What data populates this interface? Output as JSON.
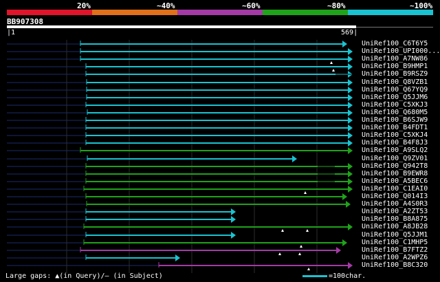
{
  "percent_labels": [
    "20%",
    "~40%",
    "~60%",
    "~80%",
    "~100%"
  ],
  "color_scale": [
    {
      "color": "#e0142a"
    },
    {
      "color": "#e0701a"
    },
    {
      "color": "#a43aa6"
    },
    {
      "color": "#1fa31a"
    },
    {
      "color": "#19c3d1"
    }
  ],
  "query": {
    "name": "BB907308",
    "start": "1",
    "end": "569"
  },
  "hits": [
    {
      "label": "UniRef100_C6T6Y5",
      "color": "#19c3d1",
      "start": 117,
      "end": 505,
      "gaps": []
    },
    {
      "label": "UniRef100_UPI000...",
      "color": "#19c3d1",
      "start": 117,
      "end": 513,
      "gaps": []
    },
    {
      "label": "UniRef100_A7NW86",
      "color": "#19c3d1",
      "start": 117,
      "end": 513,
      "gaps": [
        {
          "type": "query",
          "pos": 482
        }
      ]
    },
    {
      "label": "UniRef100_B9HMP1",
      "color": "#19c3d1",
      "start": 125,
      "end": 513,
      "gaps": [
        {
          "type": "query",
          "pos": 485
        }
      ]
    },
    {
      "label": "UniRef100_B9RSZ9",
      "color": "#19c3d1",
      "start": 125,
      "end": 513,
      "gaps": [
        {
          "type": "subject",
          "pos": 488
        }
      ]
    },
    {
      "label": "UniRef100_Q8VZB1",
      "color": "#19c3d1",
      "start": 126,
      "end": 513,
      "gaps": []
    },
    {
      "label": "UniRef100_Q67YQ9",
      "color": "#19c3d1",
      "start": 126,
      "end": 513,
      "gaps": []
    },
    {
      "label": "UniRef100_Q5JJM6",
      "color": "#19c3d1",
      "start": 126,
      "end": 513,
      "gaps": []
    },
    {
      "label": "UniRef100_C5XKJ3",
      "color": "#19c3d1",
      "start": 125,
      "end": 513,
      "gaps": []
    },
    {
      "label": "UniRef100_Q680M5",
      "color": "#19c3d1",
      "start": 127,
      "end": 513,
      "gaps": []
    },
    {
      "label": "UniRef100_B6SJW9",
      "color": "#19c3d1",
      "start": 125,
      "end": 513,
      "gaps": []
    },
    {
      "label": "UniRef100_B4FDT1",
      "color": "#19c3d1",
      "start": 125,
      "end": 513,
      "gaps": []
    },
    {
      "label": "UniRef100_C5XKJ4",
      "color": "#19c3d1",
      "start": 125,
      "end": 513,
      "gaps": []
    },
    {
      "label": "UniRef100_B4F8J3",
      "color": "#19c3d1",
      "start": 125,
      "end": 513,
      "gaps": []
    },
    {
      "label": "UniRef100_A9SLQ2",
      "color": "#1fa31a",
      "start": 117,
      "end": 513,
      "gaps": []
    },
    {
      "label": "UniRef100_Q9ZV01",
      "color": "#19c3d1",
      "start": 127,
      "end": 432,
      "gaps": []
    },
    {
      "label": "UniRef100_Q942T8",
      "color": "#1fa31a",
      "start": 125,
      "end": 513,
      "gaps": [
        {
          "type": "subject",
          "pos": 462
        }
      ]
    },
    {
      "label": "UniRef100_B9EWR8",
      "color": "#1fa31a",
      "start": 125,
      "end": 513,
      "gaps": [
        {
          "type": "subject",
          "pos": 462
        }
      ]
    },
    {
      "label": "UniRef100_A5BEC6",
      "color": "#1fa31a",
      "start": 125,
      "end": 513,
      "gaps": [
        {
          "type": "subject",
          "pos": 462
        }
      ]
    },
    {
      "label": "UniRef100_C1EAI0",
      "color": "#1fa31a",
      "start": 122,
      "end": 513,
      "gaps": [
        {
          "type": "query",
          "pos": 444
        }
      ]
    },
    {
      "label": "UniRef100_Q014I3",
      "color": "#1fa31a",
      "start": 125,
      "end": 505,
      "gaps": []
    },
    {
      "label": "UniRef100_A4S0R3",
      "color": "#1fa31a",
      "start": 126,
      "end": 510,
      "gaps": []
    },
    {
      "label": "UniRef100_A2ZT53",
      "color": "#19c3d1",
      "start": 125,
      "end": 343,
      "gaps": []
    },
    {
      "label": "UniRef100_B8A875",
      "color": "#19c3d1",
      "start": 125,
      "end": 343,
      "gaps": []
    },
    {
      "label": "UniRef100_A8JB28",
      "color": "#1fa31a",
      "start": 122,
      "end": 513,
      "gaps": [
        {
          "type": "query",
          "pos": 411
        },
        {
          "type": "query",
          "pos": 447
        }
      ]
    },
    {
      "label": "UniRef100_Q5JJM1",
      "color": "#19c3d1",
      "start": 125,
      "end": 343,
      "gaps": []
    },
    {
      "label": "UniRef100_C1MHP5",
      "color": "#1fa31a",
      "start": 122,
      "end": 505,
      "gaps": [
        {
          "type": "query",
          "pos": 438
        }
      ]
    },
    {
      "label": "UniRef100_B7FTZ2",
      "color": "#a43aa6",
      "start": 117,
      "end": 496,
      "gaps": [
        {
          "type": "query",
          "pos": 407
        },
        {
          "type": "query",
          "pos": 436
        }
      ]
    },
    {
      "label": "UniRef100_A2WPZ6",
      "color": "#19c3d1",
      "start": 125,
      "end": 262,
      "gaps": []
    },
    {
      "label": "UniRef100_B8C320",
      "color": "#a43aa6",
      "start": 231,
      "end": 513,
      "gaps": [
        {
          "type": "query",
          "pos": 449
        }
      ]
    }
  ],
  "footer": {
    "gaps_text": "Large gaps: ▲(in Query)/‒ (in Subject)",
    "scale_text": "=100char."
  }
}
